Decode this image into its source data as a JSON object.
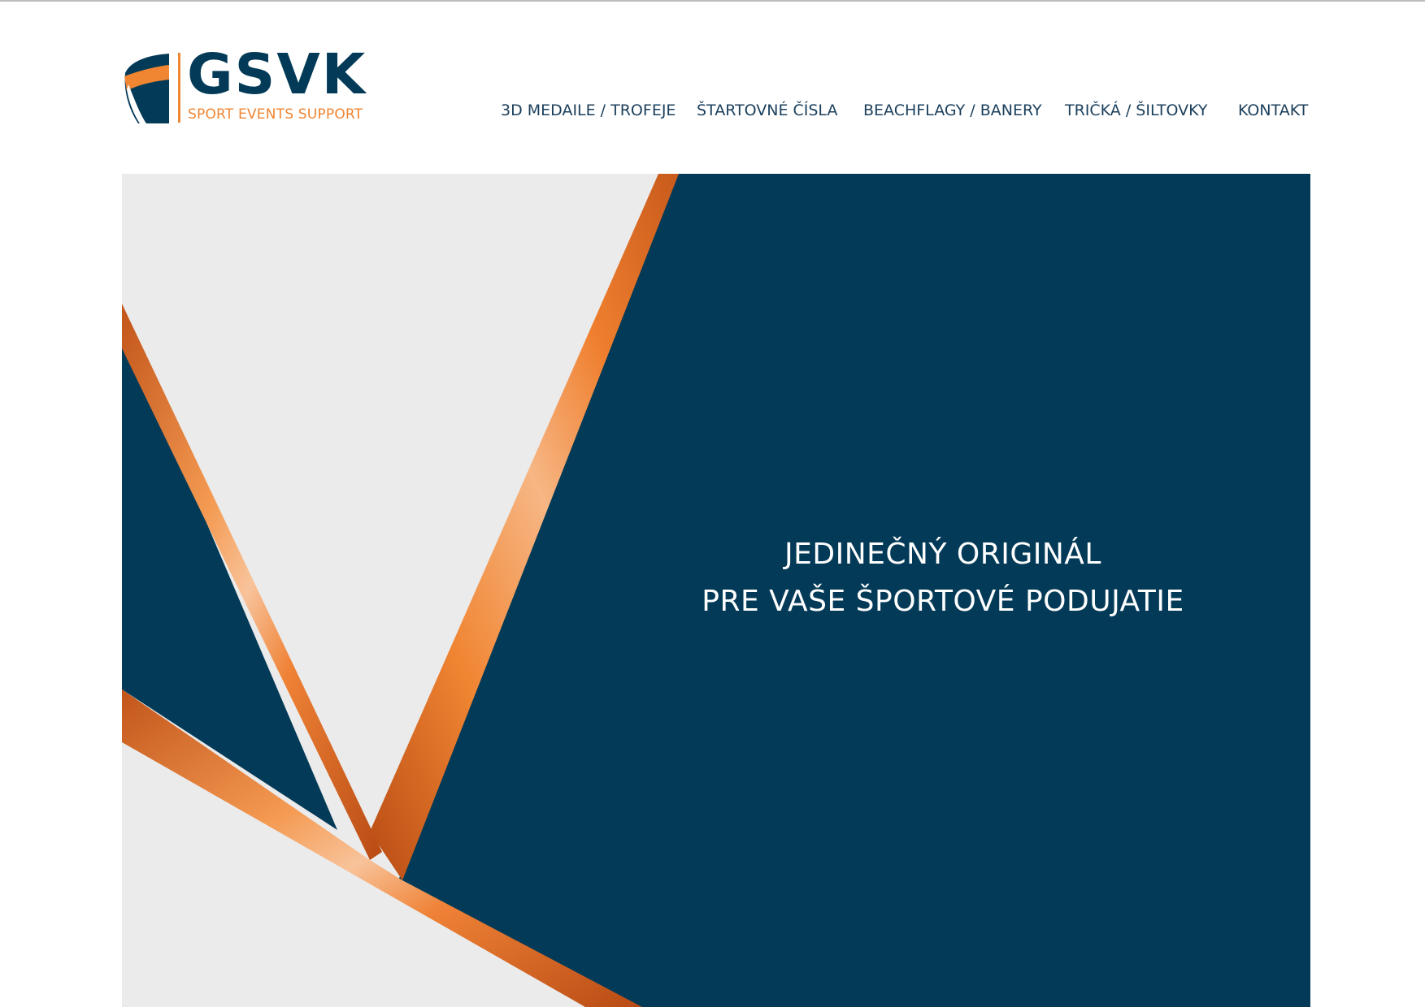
{
  "brand": {
    "name": "GSVK",
    "tagline": "SPORT EVENTS SUPPORT",
    "logo_icon": "shield-logo-icon"
  },
  "nav": {
    "items": [
      {
        "label": "3D MEDAILE / TROFEJE"
      },
      {
        "label": "ŠTARTOVNÉ ČÍSLA"
      },
      {
        "label": "BEACHFLAGY / BANERY"
      },
      {
        "label": "TRIČKÁ / ŠILTOVKY"
      },
      {
        "label": "KONTAKT"
      }
    ]
  },
  "hero": {
    "headline_line1": "JEDINEČNÝ ORIGINÁL",
    "headline_line2": "PRE VAŠE ŠPORTOVÉ PODUJATIE"
  },
  "colors": {
    "navy": "#033a57",
    "orange": "#f08532",
    "light_grey": "#ebebeb",
    "nav_text": "#1b3f5c"
  }
}
